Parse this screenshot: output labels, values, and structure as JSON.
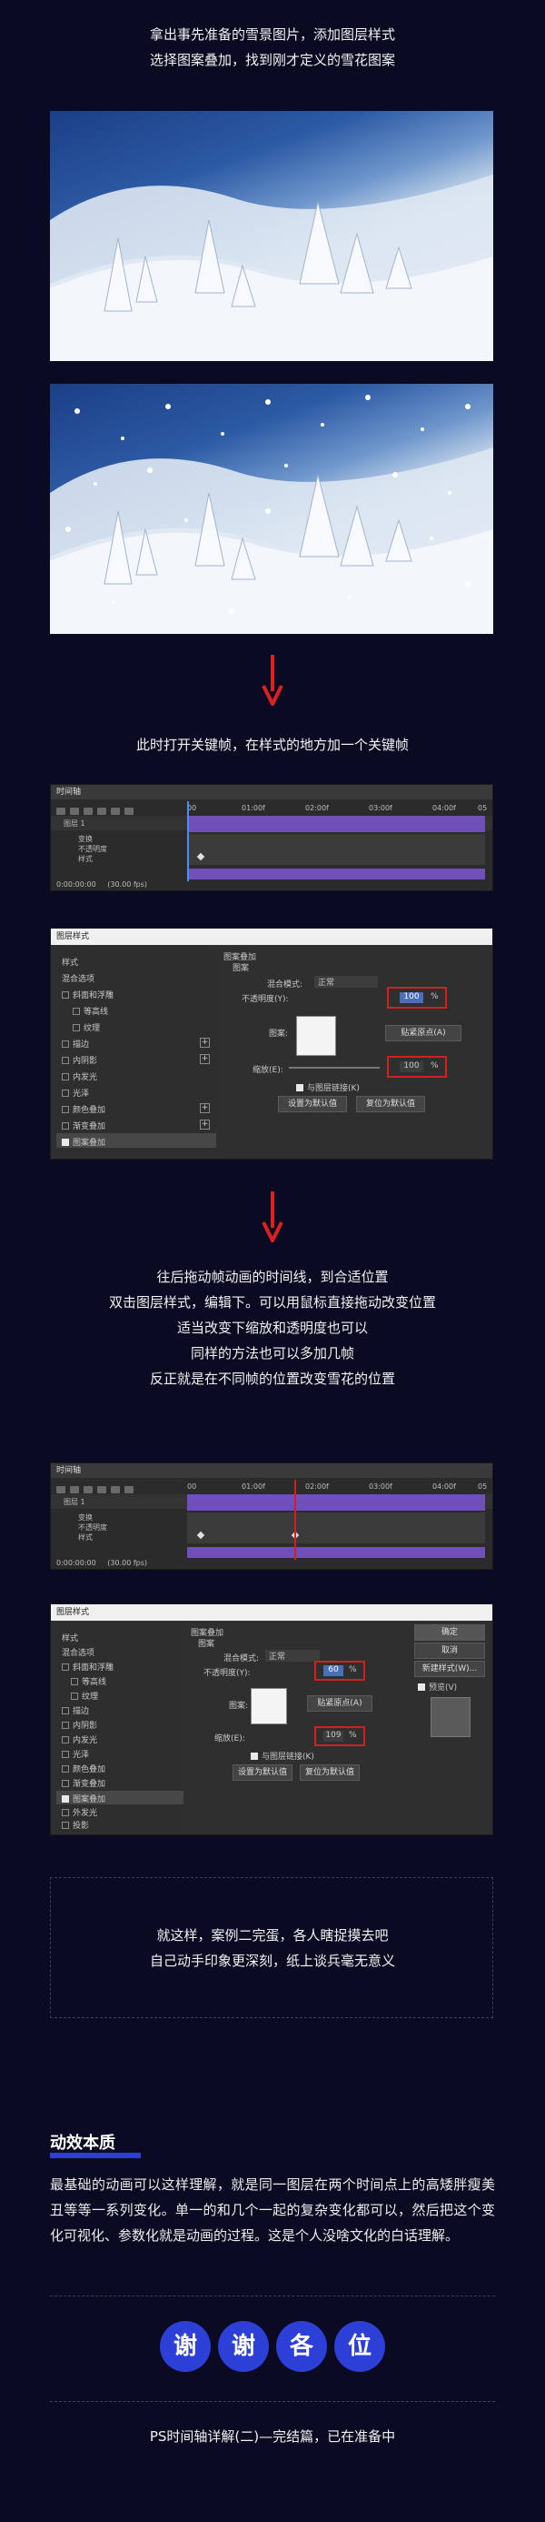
{
  "intro_lines": [
    "拿出事先准备的雪景图片，添加图层样式",
    "选择图案叠加，找到刚才定义的雪花图案"
  ],
  "keyframe_line": "此时打开关键帧，在样式的地方加一个关键帧",
  "timeline": {
    "title": "时间轴",
    "ruler": [
      "00",
      "01:00f",
      "02:00f",
      "03:00f",
      "04:00f",
      "05"
    ],
    "layer": "图层 1",
    "props": [
      "变换",
      "不透明度",
      "样式"
    ],
    "time": "0:00:00:00",
    "fps": "(30.00 fps)"
  },
  "dialog1": {
    "title": "图层样式",
    "left_items": [
      "样式",
      "混合选项",
      "斜面和浮雕",
      "等高线",
      "纹理",
      "描边",
      "内阴影",
      "内发光",
      "光泽",
      "颜色叠加",
      "渐变叠加",
      "图案叠加",
      "外发光",
      "投影"
    ],
    "section": "图案叠加",
    "subsection": "图案",
    "blend_label": "混合模式:",
    "blend_value": "正常",
    "opacity_label": "不透明度(Y):",
    "opacity_value": "100",
    "percent": "%",
    "pattern_label": "图案:",
    "snap_label": "贴紧原点(A)",
    "scale_label": "缩放(E):",
    "scale_value": "100",
    "link_label": "与图层链接(K)",
    "default_btn": "设置为默认值",
    "reset_btn": "复位为默认值"
  },
  "middle_lines": [
    "往后拖动帧动画的时间线，到合适位置",
    "双击图层样式，编辑下。可以用鼠标直接拖动改变位置",
    "适当改变下缩放和透明度也可以",
    "同样的方法也可以多加几帧",
    "反正就是在不同帧的位置改变雪花的位置"
  ],
  "dialog2": {
    "title": "图层样式",
    "opacity_value": "60",
    "scale_value": "109",
    "ok": "确定",
    "cancel": "取消",
    "new_style": "新建样式(W)...",
    "preview": "预览(V)"
  },
  "box_lines": [
    "就这样，案例二完蛋，各人瞎捉摸去吧",
    "自己动手印象更深刻，纸上谈兵毫无意义"
  ],
  "section_title": "动效本质",
  "paragraph": "最基础的动画可以这样理解，就是同一图层在两个时间点上的高矮胖瘦美丑等等一系列变化。单一的和几个一起的复杂变化都可以，然后把这个变化可视化、参数化就是动画的过程。这是个人没啥文化的白话理解。",
  "thanks": [
    "谢",
    "谢",
    "各",
    "位"
  ],
  "footer": "PS时间轴详解(二)—完结篇，已在准备中",
  "colors": {
    "background": "#0a0b22",
    "accent": "#2c40d8",
    "arrow": "#e02020",
    "timeline_bar": "#6f4fb8",
    "highlight": "#d21f1f"
  }
}
